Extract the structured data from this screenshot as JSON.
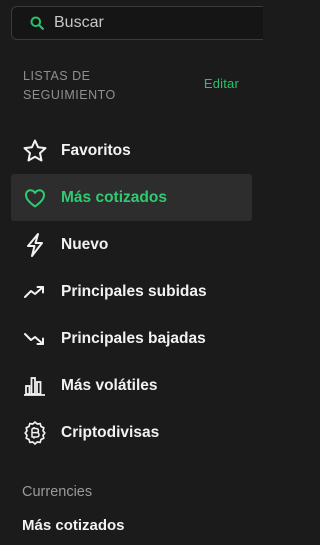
{
  "search": {
    "placeholder": "Buscar",
    "value": "",
    "icon": "search-icon"
  },
  "lists": {
    "title": "LISTAS DE SEGUIMIENTO",
    "edit_label": "Editar",
    "items": [
      {
        "label": "Favoritos",
        "icon": "star-icon",
        "active": false
      },
      {
        "label": "Más cotizados",
        "icon": "heart-icon",
        "active": true
      },
      {
        "label": "Nuevo",
        "icon": "lightning-icon",
        "active": false
      },
      {
        "label": "Principales subidas",
        "icon": "trending-up-icon",
        "active": false
      },
      {
        "label": "Principales bajadas",
        "icon": "trending-down-icon",
        "active": false
      },
      {
        "label": "Más volátiles",
        "icon": "bar-chart-icon",
        "active": false
      },
      {
        "label": "Criptodivisas",
        "icon": "bitcoin-icon",
        "active": false
      }
    ]
  },
  "currencies": {
    "title": "Currencies",
    "items": [
      {
        "label": "Más cotizados"
      }
    ]
  },
  "colors": {
    "background": "#1b1b1b",
    "accent": "#2ecc71",
    "text": "#f2f2f2",
    "muted": "#8f8f8f",
    "active_row": "#2d2d2d"
  }
}
